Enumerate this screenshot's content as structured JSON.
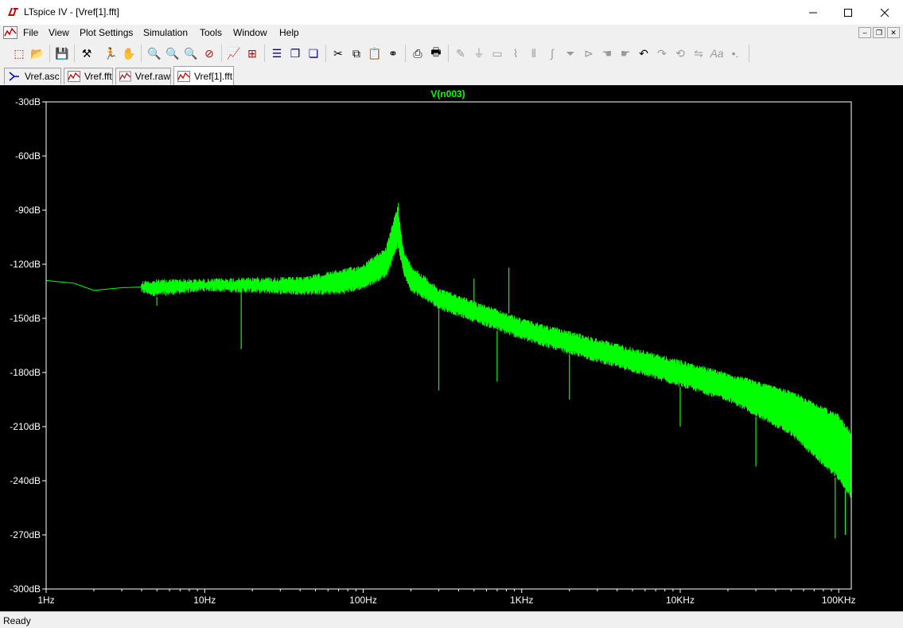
{
  "window": {
    "title": "LTspice IV - [Vref[1].fft]"
  },
  "menu": [
    "File",
    "View",
    "Plot Settings",
    "Simulation",
    "Tools",
    "Window",
    "Help"
  ],
  "tabs": [
    {
      "label": "Vref.asc",
      "icon": "schematic-icon",
      "active": false
    },
    {
      "label": "Vref.fft",
      "icon": "waveform-icon",
      "active": false
    },
    {
      "label": "Vref.raw",
      "icon": "waveform-icon",
      "active": false
    },
    {
      "label": "Vref[1].fft",
      "icon": "waveform-icon",
      "active": true
    }
  ],
  "status": {
    "text": "Ready"
  },
  "colors": {
    "trace": "#00ff00",
    "plot_bg": "#000000",
    "axis": "#ffffff"
  },
  "chart_data": {
    "type": "line",
    "title": "V(n003)",
    "x_scale": "log",
    "xlim": [
      1,
      120000
    ],
    "ylim": [
      -300,
      -30
    ],
    "x_ticks": [
      "1Hz",
      "10Hz",
      "100Hz",
      "1KHz",
      "10KHz",
      "100KHz"
    ],
    "y_ticks": [
      "-30dB",
      "-60dB",
      "-90dB",
      "-120dB",
      "-150dB",
      "-180dB",
      "-210dB",
      "-240dB",
      "-270dB",
      "-300dB"
    ],
    "series": [
      {
        "name": "V(n003)",
        "envelope_upper": [
          [
            1,
            -128
          ],
          [
            1.5,
            -130
          ],
          [
            2,
            -134
          ],
          [
            3,
            -132
          ],
          [
            4,
            -129
          ],
          [
            6,
            -128
          ],
          [
            10,
            -128
          ],
          [
            20,
            -127
          ],
          [
            40,
            -127
          ],
          [
            70,
            -123
          ],
          [
            100,
            -120
          ],
          [
            140,
            -110
          ],
          [
            165,
            -87
          ],
          [
            180,
            -112
          ],
          [
            200,
            -120
          ],
          [
            300,
            -133
          ],
          [
            500,
            -140
          ],
          [
            1000,
            -150
          ],
          [
            2000,
            -157
          ],
          [
            5000,
            -166
          ],
          [
            10000,
            -173
          ],
          [
            20000,
            -180
          ],
          [
            50000,
            -190
          ],
          [
            100000,
            -203
          ],
          [
            120000,
            -213
          ]
        ],
        "envelope_lower": [
          [
            1,
            -130
          ],
          [
            1.5,
            -131
          ],
          [
            2,
            -135
          ],
          [
            3,
            -134
          ],
          [
            5,
            -138
          ],
          [
            10,
            -135
          ],
          [
            20,
            -136
          ],
          [
            40,
            -137
          ],
          [
            70,
            -137
          ],
          [
            100,
            -134
          ],
          [
            140,
            -127
          ],
          [
            165,
            -110
          ],
          [
            180,
            -126
          ],
          [
            200,
            -135
          ],
          [
            300,
            -145
          ],
          [
            500,
            -152
          ],
          [
            1000,
            -162
          ],
          [
            2000,
            -170
          ],
          [
            5000,
            -180
          ],
          [
            10000,
            -188
          ],
          [
            20000,
            -196
          ],
          [
            50000,
            -215
          ],
          [
            100000,
            -240
          ],
          [
            120000,
            -250
          ]
        ],
        "peaks": [
          [
            167,
            -86
          ],
          [
            500,
            -128
          ],
          [
            830,
            -122
          ]
        ],
        "notches": [
          [
            5,
            -143
          ],
          [
            17,
            -167
          ],
          [
            300,
            -190
          ],
          [
            700,
            -185
          ],
          [
            2000,
            -195
          ],
          [
            10000,
            -210
          ],
          [
            30000,
            -232
          ],
          [
            95000,
            -272
          ],
          [
            110000,
            -270
          ]
        ]
      }
    ]
  }
}
